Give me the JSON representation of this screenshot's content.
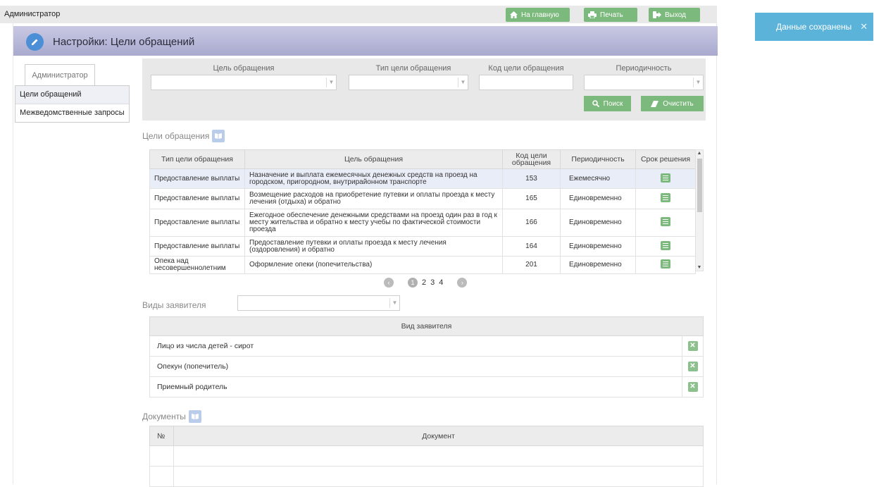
{
  "topbar": {
    "user": "Администратор",
    "home_label": "На главную",
    "print_label": "Печать",
    "exit_label": "Выход"
  },
  "toast": {
    "message": "Данные сохранены",
    "close": "✕"
  },
  "header": {
    "title": "Настройки: Цели обращений"
  },
  "sidebar": {
    "heading": "Администратор",
    "items": [
      {
        "label": "Цели обращений"
      },
      {
        "label": "Межведомственные запросы"
      }
    ]
  },
  "filters": {
    "goal_label": "Цель обращения",
    "type_label": "Тип цели обращения",
    "code_label": "Код цели обращения",
    "period_label": "Периодичность",
    "search_label": "Поиск",
    "clear_label": "Очистить"
  },
  "goals_table": {
    "section_title": "Цели обращения",
    "headers": [
      "Тип цели обращения",
      "Цель обращения",
      "Код цели обращения",
      "Периодичность",
      "Срок решения"
    ],
    "rows": [
      {
        "type": "Предоставление выплаты",
        "goal": "Назначение и выплата ежемесячных денежных средств на проезд на городском, пригородном, внутрирайонном транспорте",
        "code": "153",
        "period": "Ежемесячно"
      },
      {
        "type": "Предоставление выплаты",
        "goal": "Возмещение расходов на приобретение путевки и оплаты проезда к месту лечения (отдыха) и обратно",
        "code": "165",
        "period": "Единовременно"
      },
      {
        "type": "Предоставление выплаты",
        "goal": "Ежегодное обеспечение денежными средствами на проезд один раз в год к месту жительства и обратно к месту учебы по фактической стоимости проезда",
        "code": "166",
        "period": "Единовременно"
      },
      {
        "type": "Предоставление выплаты",
        "goal": "Предоставление путевки и оплаты проезда к месту лечения (оздоровления) и обратно",
        "code": "164",
        "period": "Единовременно"
      },
      {
        "type": "Опека над несовершеннолетним",
        "goal": "Оформление опеки (попечительства)",
        "code": "201",
        "period": "Единовременно"
      }
    ]
  },
  "pager": {
    "pages": [
      "1",
      "2",
      "3",
      "4"
    ],
    "current": "1"
  },
  "applicants": {
    "label": "Виды заявителя",
    "header": "Вид заявителя",
    "rows": [
      {
        "name": "Лицо из числа детей - сирот"
      },
      {
        "name": "Опекун (попечитель)"
      },
      {
        "name": "Приемный родитель"
      }
    ]
  },
  "documents": {
    "section_title": "Документы",
    "headers": [
      "№",
      "Документ"
    ]
  },
  "colors": {
    "accent_green": "#7cb97c",
    "toast_blue": "#5bb3d9",
    "header_purple": "#a9a9cf"
  }
}
